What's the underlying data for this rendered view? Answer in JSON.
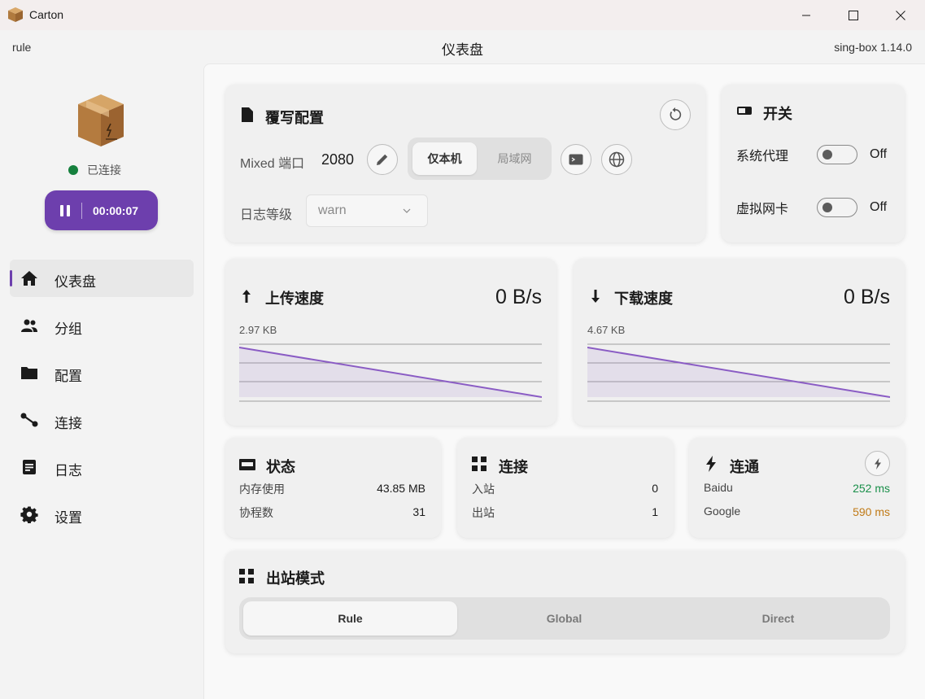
{
  "window": {
    "title": "Carton",
    "icons": {
      "app": "cardboard-box-icon",
      "minimize": "minimize-icon",
      "maximize": "maximize-icon",
      "close": "close-icon"
    }
  },
  "header": {
    "mode": "rule",
    "title": "仪表盘",
    "version": "sing-box 1.14.0"
  },
  "sidebar": {
    "status": "已连接",
    "status_color": "#15803d",
    "timer": "00:00:07",
    "accent": "#6d3fad",
    "nav": [
      {
        "label": "仪表盘",
        "icon": "home-icon",
        "active": true
      },
      {
        "label": "分组",
        "icon": "group-icon",
        "active": false
      },
      {
        "label": "配置",
        "icon": "folder-icon",
        "active": false
      },
      {
        "label": "连接",
        "icon": "connection-icon",
        "active": false
      },
      {
        "label": "日志",
        "icon": "log-icon",
        "active": false
      },
      {
        "label": "设置",
        "icon": "gear-icon",
        "active": false
      }
    ]
  },
  "override": {
    "title": "覆写配置",
    "port_label": "Mixed 端口",
    "port_value": "2080",
    "scope_options": [
      "仅本机",
      "局域网"
    ],
    "scope_selected": "仅本机",
    "log_label": "日志等级",
    "log_level": "warn"
  },
  "switches": {
    "title": "开关",
    "items": [
      {
        "label": "系统代理",
        "state": "Off"
      },
      {
        "label": "虚拟网卡",
        "state": "Off"
      }
    ]
  },
  "upload": {
    "title": "上传速度",
    "speed": "0 B/s",
    "peak": "2.97 KB"
  },
  "download": {
    "title": "下载速度",
    "speed": "0 B/s",
    "peak": "4.67 KB"
  },
  "status": {
    "title": "状态",
    "rows": [
      {
        "label": "内存使用",
        "value": "43.85 MB"
      },
      {
        "label": "协程数",
        "value": "31"
      }
    ]
  },
  "connections": {
    "title": "连接",
    "rows": [
      {
        "label": "入站",
        "value": "0"
      },
      {
        "label": "出站",
        "value": "1"
      }
    ]
  },
  "connectivity": {
    "title": "连通",
    "rows": [
      {
        "label": "Baidu",
        "value": "252 ms",
        "color": "#1a8f4a"
      },
      {
        "label": "Google",
        "value": "590 ms",
        "color": "#c07a16"
      }
    ]
  },
  "outbound": {
    "title": "出站模式",
    "options": [
      "Rule",
      "Global",
      "Direct"
    ],
    "selected": "Rule"
  }
}
